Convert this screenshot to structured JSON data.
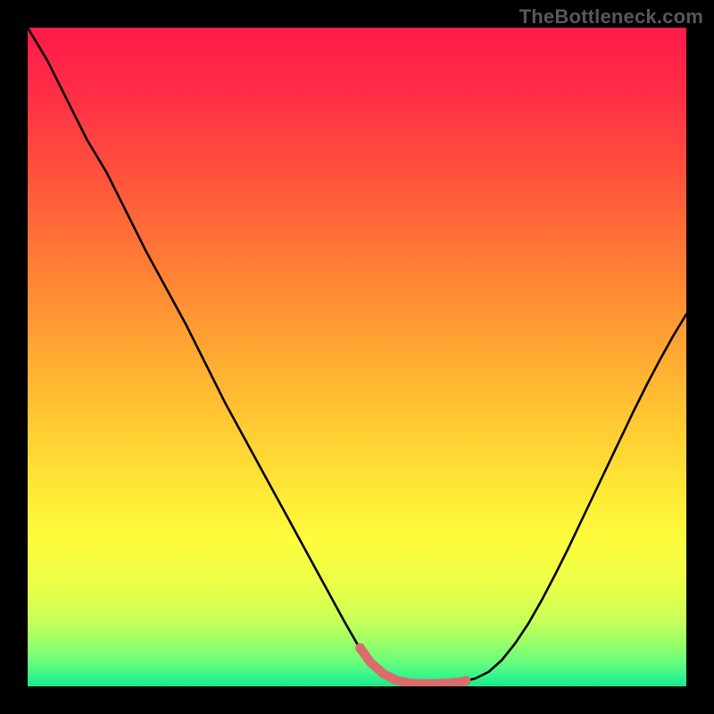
{
  "watermark": "TheBottleneck.com",
  "colors": {
    "background": "#000000",
    "watermark": "#585858",
    "curve_stroke": "#000000",
    "highlight": "#d96d6d",
    "gradient_stops": [
      {
        "offset": 0.0,
        "color": "#ff1a4a"
      },
      {
        "offset": 0.1,
        "color": "#ff2e46"
      },
      {
        "offset": 0.2,
        "color": "#ff4b3e"
      },
      {
        "offset": 0.3,
        "color": "#ff6a38"
      },
      {
        "offset": 0.4,
        "color": "#ff8a34"
      },
      {
        "offset": 0.5,
        "color": "#ffaa32"
      },
      {
        "offset": 0.6,
        "color": "#ffc932"
      },
      {
        "offset": 0.7,
        "color": "#ffe736"
      },
      {
        "offset": 0.78,
        "color": "#fdfc3d"
      },
      {
        "offset": 0.85,
        "color": "#e9ff4a"
      },
      {
        "offset": 0.9,
        "color": "#c8ff58"
      },
      {
        "offset": 0.93,
        "color": "#9fff67"
      },
      {
        "offset": 0.96,
        "color": "#6dff79"
      },
      {
        "offset": 0.985,
        "color": "#35f58d"
      },
      {
        "offset": 1.0,
        "color": "#19e98a"
      }
    ]
  },
  "chart_data": {
    "type": "line",
    "title": "",
    "xlabel": "",
    "ylabel": "",
    "xlim": [
      0,
      100
    ],
    "ylim": [
      0,
      100
    ],
    "x": [
      0,
      3,
      6,
      9,
      12,
      15,
      18,
      21,
      24,
      27,
      30,
      33,
      36,
      39,
      42,
      45,
      48,
      50,
      52,
      54,
      56,
      58,
      60,
      62,
      64,
      66,
      68,
      70,
      72,
      74,
      76,
      78,
      80,
      82,
      84,
      86,
      88,
      90,
      92,
      94,
      96,
      98,
      100
    ],
    "values": [
      100,
      95,
      89,
      83,
      78,
      72,
      66,
      60.5,
      55,
      49,
      43,
      37.5,
      32,
      26.5,
      21,
      15.5,
      10,
      6.5,
      3.7,
      1.9,
      0.9,
      0.5,
      0.4,
      0.4,
      0.5,
      0.7,
      1.2,
      2.2,
      4.0,
      6.5,
      9.5,
      13.0,
      16.8,
      20.8,
      25.0,
      29.2,
      33.4,
      37.6,
      41.8,
      45.8,
      49.6,
      53.2,
      56.5
    ],
    "highlight_range_x": [
      50.5,
      66.5
    ]
  }
}
